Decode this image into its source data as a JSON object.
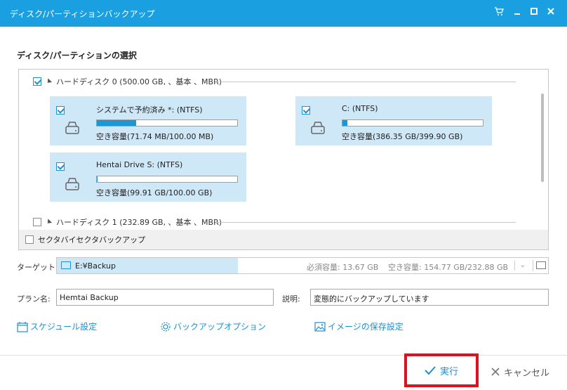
{
  "window": {
    "title": "ディスク/パーティションバックアップ",
    "controls": [
      "cart-icon",
      "minimize-icon",
      "maximize-icon",
      "close-icon"
    ]
  },
  "section": {
    "title": "ディスク/パーティションの選択"
  },
  "disks": [
    {
      "label": "ハードディスク 0 (500.00 GB, 、基本 、MBR)",
      "checked": true,
      "partitions": [
        {
          "name": "システムで予約済み *: (NTFS)",
          "capacity": "空き容量(71.74 MB/100.00 MB)",
          "used_fraction": 0.28,
          "checked": true
        },
        {
          "name": "C: (NTFS)",
          "capacity": "空き容量(386.35 GB/399.90 GB)",
          "used_fraction": 0.034,
          "checked": true
        },
        {
          "name": "Hentai Drive S: (NTFS)",
          "capacity": "空き容量(99.91 GB/100.00 GB)",
          "used_fraction": 0.001,
          "checked": true
        }
      ]
    },
    {
      "label": "ハードディスク 1 (232.89 GB, 、基本 、MBR)",
      "checked": false
    }
  ],
  "sector": {
    "label": "セクタバイセクタバックアップ",
    "checked": false
  },
  "target": {
    "label": "ターゲット:",
    "path": "E:¥Backup",
    "required": "必須容量: 13.67 GB",
    "free": "空き容量: 154.77 GB/232.88 GB"
  },
  "plan": {
    "label": "プラン名:",
    "value": "Hemtai Backup"
  },
  "description": {
    "label": "説明:",
    "value": "変態的にバックアップしています"
  },
  "links": {
    "schedule": "スケジュール設定",
    "options": "バックアップオプション",
    "image_settings": "イメージの保存設定"
  },
  "buttons": {
    "run": "実行",
    "cancel": "キャンセル"
  },
  "colors": {
    "accent": "#1aa0e0",
    "selected": "#cfe8f8",
    "highlight_border": "#e0101e"
  }
}
